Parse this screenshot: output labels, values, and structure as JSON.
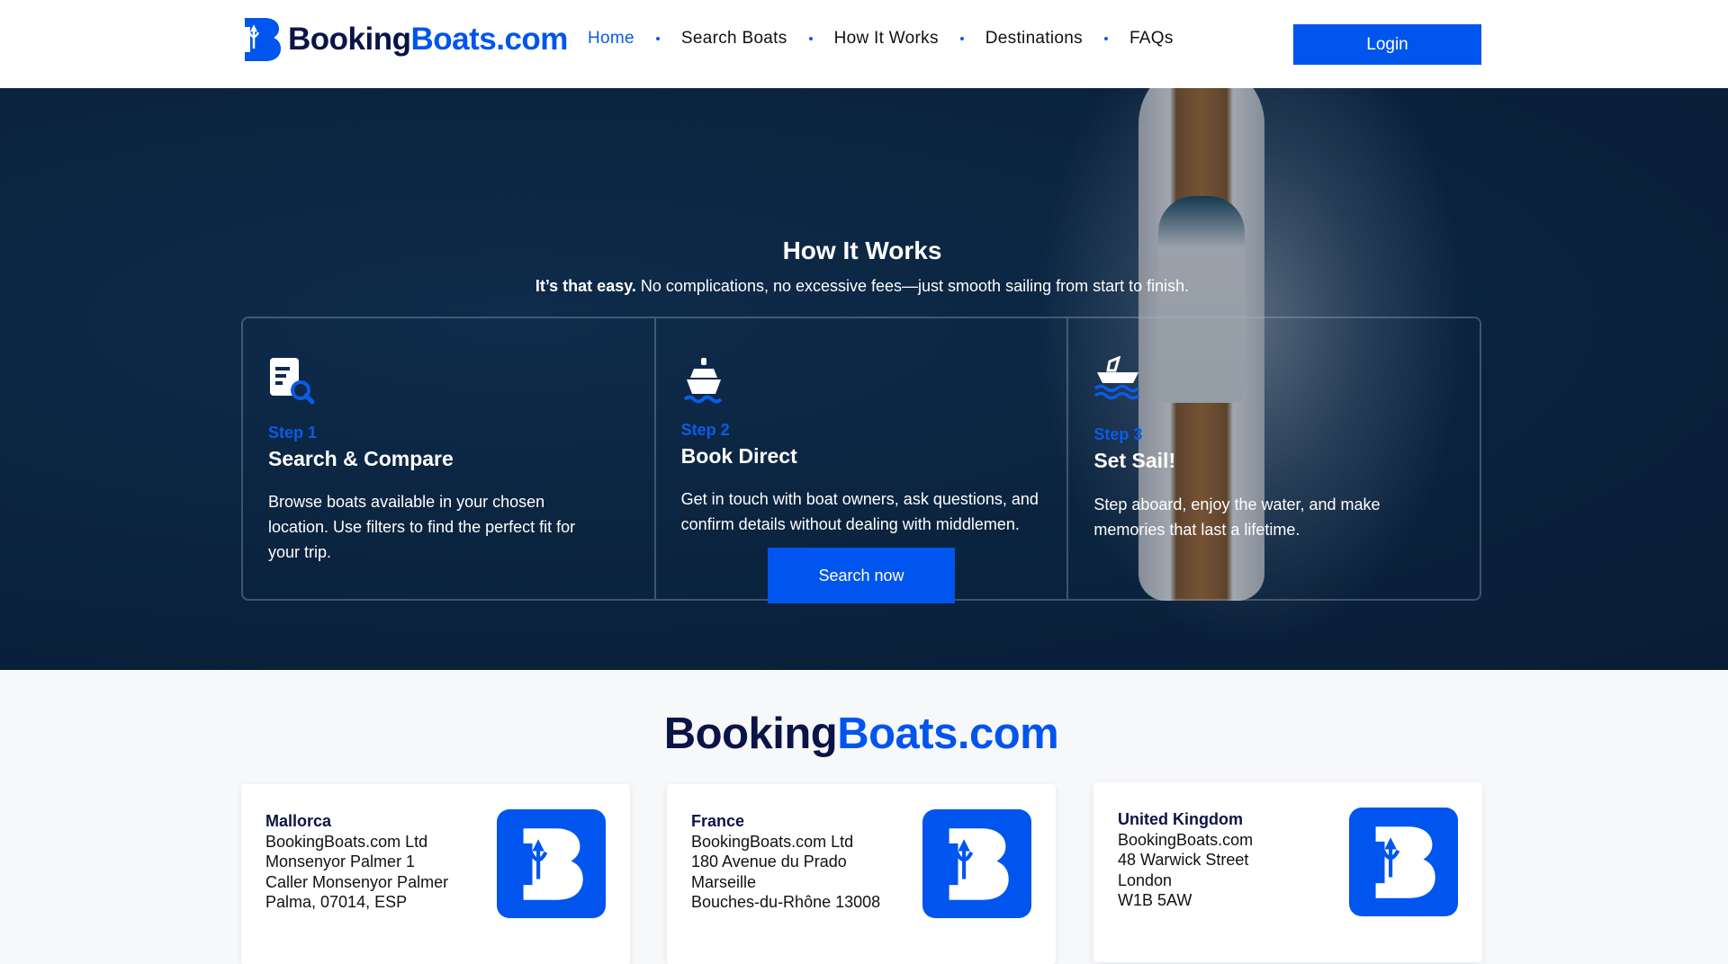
{
  "header": {
    "logo_part1": "Booking",
    "logo_part2": "Boats.com",
    "nav": [
      {
        "label": "Home"
      },
      {
        "label": "Search Boats"
      },
      {
        "label": "How It Works"
      },
      {
        "label": "Destinations"
      },
      {
        "label": "FAQs"
      }
    ],
    "login": "Login"
  },
  "hero": {
    "title": "How It Works",
    "subtitle_bold": "It’s that easy.",
    "subtitle": " No complications, no excessive fees—just smooth sailing from start to finish.",
    "steps": [
      {
        "step": "Step 1",
        "title": "Search & Compare",
        "desc": "Browse boats available in your chosen location. Use filters to find the perfect fit for your trip.",
        "icon": "document-search-icon"
      },
      {
        "step": "Step 2",
        "title": "Book Direct",
        "desc": "Get in touch with boat owners, ask questions, and confirm details without dealing with middlemen.",
        "icon": "ship-icon"
      },
      {
        "step": "Step 3",
        "title": "Set Sail!",
        "desc": "Step aboard, enjoy the water, and make memories that last a lifetime.",
        "icon": "speedboat-icon"
      }
    ],
    "cta": "Search now"
  },
  "footer": {
    "logo_part1": "Booking",
    "logo_part2": "Boats.com",
    "offices": [
      {
        "name": "Mallorca",
        "lines": [
          "BookingBoats.com Ltd",
          "Monsenyor Palmer 1",
          "Caller Monsenyor Palmer",
          "Palma, 07014, ESP"
        ]
      },
      {
        "name": "France",
        "lines": [
          "BookingBoats.com Ltd",
          "180 Avenue du Prado",
          "Marseille",
          "Bouches-du-Rhône 13008"
        ]
      },
      {
        "name": "United Kingdom",
        "lines": [
          "BookingBoats.com",
          "48 Warwick Street",
          "London",
          "W1B 5AW"
        ]
      }
    ]
  },
  "colors": {
    "brand": "#0055ee",
    "navy": "#0b1446"
  }
}
